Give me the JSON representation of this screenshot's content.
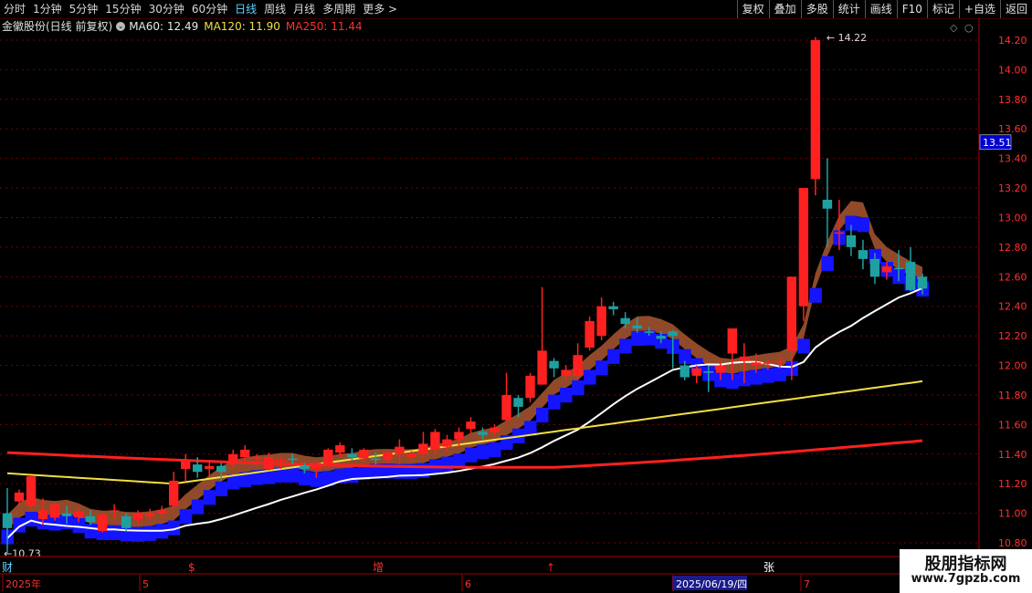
{
  "toolbar": {
    "left": [
      {
        "label": "分时",
        "active": false
      },
      {
        "label": "1分钟",
        "active": false
      },
      {
        "label": "5分钟",
        "active": false
      },
      {
        "label": "15分钟",
        "active": false
      },
      {
        "label": "30分钟",
        "active": false
      },
      {
        "label": "60分钟",
        "active": false
      },
      {
        "label": "日线",
        "active": true
      },
      {
        "label": "周线",
        "active": false
      },
      {
        "label": "月线",
        "active": false
      },
      {
        "label": "多周期",
        "active": false
      },
      {
        "label": "更多 >",
        "active": false
      }
    ],
    "right": [
      "复权",
      "叠加",
      "多股",
      "统计",
      "画线",
      "F10",
      "标记",
      "+自选",
      "返回"
    ]
  },
  "info": {
    "title": "金徽股份(日线 前复权)",
    "ma60": "MA60: 12.49",
    "ma120": "MA120: 11.90",
    "ma250": "MA250: 11.44"
  },
  "colors": {
    "up": "#ff2020",
    "down": "#1fa0a0",
    "ma60": "#ffffff",
    "ma120": "#f0e040",
    "ma250": "#ff2020",
    "band": "#a0522d",
    "blue": "#1414ff"
  },
  "chart_data": {
    "type": "candlestick",
    "ylim": [
      10.8,
      14.3
    ],
    "yticks": [
      "14.20",
      "14.00",
      "13.80",
      "13.60",
      "13.40",
      "13.20",
      "13.00",
      "12.80",
      "12.60",
      "12.40",
      "12.20",
      "12.00",
      "11.80",
      "11.60",
      "11.40",
      "11.20",
      "11.00",
      "10.80"
    ],
    "current_price": "13.51",
    "high_label": "14.22",
    "low_label": "10.73",
    "candles": [
      [
        11.0,
        10.9,
        11.17,
        10.73
      ],
      [
        11.08,
        11.14,
        11.16,
        11.05
      ],
      [
        11.05,
        11.25,
        11.25,
        11.03
      ],
      [
        10.96,
        11.02,
        11.1,
        10.92
      ],
      [
        10.97,
        11.06,
        11.07,
        10.95
      ],
      [
        11.0,
        10.98,
        11.05,
        10.93
      ],
      [
        10.97,
        11.01,
        11.03,
        10.94
      ],
      [
        10.98,
        10.94,
        11.02,
        10.92
      ],
      [
        10.88,
        10.99,
        11.0,
        10.87
      ],
      [
        11.02,
        11.02,
        11.06,
        10.96
      ],
      [
        10.98,
        10.9,
        11.0,
        10.88
      ],
      [
        10.96,
        11.0,
        11.02,
        10.92
      ],
      [
        10.98,
        11.0,
        11.03,
        10.95
      ],
      [
        11.0,
        11.02,
        11.05,
        10.97
      ],
      [
        11.05,
        11.22,
        11.28,
        11.03
      ],
      [
        11.3,
        11.35,
        11.4,
        11.22
      ],
      [
        11.33,
        11.28,
        11.38,
        11.24
      ],
      [
        11.3,
        11.32,
        11.35,
        11.25
      ],
      [
        11.32,
        11.28,
        11.34,
        11.22
      ],
      [
        11.33,
        11.4,
        11.43,
        11.3
      ],
      [
        11.38,
        11.43,
        11.46,
        11.34
      ],
      [
        11.37,
        11.38,
        11.4,
        11.35
      ],
      [
        11.3,
        11.38,
        11.41,
        11.29
      ],
      [
        11.35,
        11.36,
        11.38,
        11.3
      ],
      [
        11.37,
        11.36,
        11.4,
        11.33
      ],
      [
        11.32,
        11.3,
        11.34,
        11.27
      ],
      [
        11.3,
        11.34,
        11.35,
        11.24
      ],
      [
        11.33,
        11.43,
        11.44,
        11.31
      ],
      [
        11.41,
        11.46,
        11.48,
        11.38
      ],
      [
        11.4,
        11.38,
        11.44,
        11.36
      ],
      [
        11.37,
        11.43,
        11.44,
        11.35
      ],
      [
        11.37,
        11.36,
        11.41,
        11.33
      ],
      [
        11.36,
        11.41,
        11.43,
        11.34
      ],
      [
        11.4,
        11.45,
        11.5,
        11.33
      ],
      [
        11.38,
        11.4,
        11.42,
        11.35
      ],
      [
        11.4,
        11.47,
        11.55,
        11.38
      ],
      [
        11.43,
        11.55,
        11.57,
        11.4
      ],
      [
        11.45,
        11.5,
        11.53,
        11.41
      ],
      [
        11.5,
        11.55,
        11.58,
        11.45
      ],
      [
        11.57,
        11.62,
        11.65,
        11.54
      ],
      [
        11.55,
        11.53,
        11.58,
        11.5
      ],
      [
        11.55,
        11.58,
        11.6,
        11.53
      ],
      [
        11.63,
        11.8,
        11.95,
        11.62
      ],
      [
        11.78,
        11.72,
        11.8,
        11.65
      ],
      [
        11.78,
        11.93,
        11.95,
        11.75
      ],
      [
        11.87,
        12.1,
        12.53,
        11.87
      ],
      [
        12.03,
        11.98,
        12.05,
        11.92
      ],
      [
        11.93,
        11.97,
        12.0,
        11.9
      ],
      [
        11.93,
        12.07,
        12.15,
        11.9
      ],
      [
        12.12,
        12.3,
        12.33,
        12.1
      ],
      [
        12.2,
        12.4,
        12.46,
        12.17
      ],
      [
        12.4,
        12.38,
        12.43,
        12.34
      ],
      [
        12.32,
        12.28,
        12.36,
        12.25
      ],
      [
        12.27,
        12.25,
        12.32,
        12.22
      ],
      [
        12.23,
        12.22,
        12.26,
        12.2
      ],
      [
        12.2,
        12.18,
        12.23,
        12.15
      ],
      [
        12.23,
        12.2,
        12.24,
        11.98
      ],
      [
        12.0,
        11.92,
        12.03,
        11.9
      ],
      [
        11.93,
        11.98,
        12.0,
        11.88
      ],
      [
        11.96,
        11.95,
        12.0,
        11.82
      ],
      [
        11.95,
        12.0,
        12.02,
        11.9
      ],
      [
        12.08,
        12.25,
        12.25,
        11.9
      ],
      [
        12.03,
        12.06,
        12.15,
        11.88
      ],
      [
        12.0,
        12.02,
        12.08,
        11.95
      ],
      [
        12.01,
        12.02,
        12.04,
        11.97
      ],
      [
        12.02,
        12.03,
        12.06,
        11.98
      ],
      [
        12.1,
        12.6,
        12.6,
        11.9
      ],
      [
        12.4,
        13.2,
        13.2,
        12.3
      ],
      [
        13.26,
        14.2,
        14.22,
        13.15
      ],
      [
        13.12,
        13.06,
        13.4,
        12.8
      ],
      [
        12.9,
        12.9,
        13.12,
        12.78
      ],
      [
        12.88,
        12.8,
        12.95,
        12.74
      ],
      [
        12.78,
        12.72,
        12.85,
        12.65
      ],
      [
        12.72,
        12.6,
        12.76,
        12.55
      ],
      [
        12.63,
        12.67,
        12.7,
        12.58
      ],
      [
        12.66,
        12.65,
        12.78,
        12.57
      ],
      [
        12.7,
        12.51,
        12.8,
        12.5
      ],
      [
        12.6,
        12.52,
        12.62,
        12.48
      ]
    ]
  },
  "bottom_axis": {
    "labels": [
      "2025年",
      "5",
      "6",
      "2025/06/19/四",
      "7"
    ],
    "markers": [
      "财",
      "$",
      "增",
      "↑",
      "张"
    ]
  },
  "watermark": {
    "line1": "股朋指标网",
    "line2": "www.7gpzb.com"
  }
}
